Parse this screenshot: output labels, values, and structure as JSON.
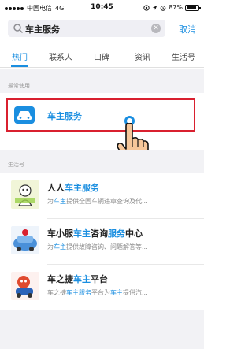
{
  "status_bar": {
    "carrier": "中国电信",
    "network": "4G",
    "time": "10:45",
    "battery": "87%",
    "battery_level": 0.87
  },
  "search": {
    "value": "车主服务",
    "cancel_label": "取消"
  },
  "tabs": [
    {
      "label": "热门"
    },
    {
      "label": "联系人"
    },
    {
      "label": "口碑"
    },
    {
      "label": "资讯"
    },
    {
      "label": "生活号"
    }
  ],
  "recent": {
    "section_label": "最常使用",
    "item_label": "车主服务"
  },
  "life_accounts": {
    "section_label": "生活号",
    "items": [
      {
        "title_parts": [
          "人人",
          "车主服务",
          ""
        ],
        "desc_parts": [
          "为",
          "车主",
          "提供全国车辆违章查询及代..."
        ]
      },
      {
        "title_parts": [
          "车小服",
          "车主",
          "咨询",
          "服务",
          "中心"
        ],
        "desc_parts": [
          "为",
          "车主",
          "提供故障咨询、问题解答等..."
        ]
      },
      {
        "title_parts": [
          "车之捷",
          "车主",
          "平台"
        ],
        "desc_parts": [
          "车之捷",
          "车主服务",
          "平台为",
          "车主",
          "提供汽..."
        ]
      }
    ]
  },
  "colors": {
    "accent": "#1a8ee0",
    "highlight_border": "#d9202f"
  }
}
